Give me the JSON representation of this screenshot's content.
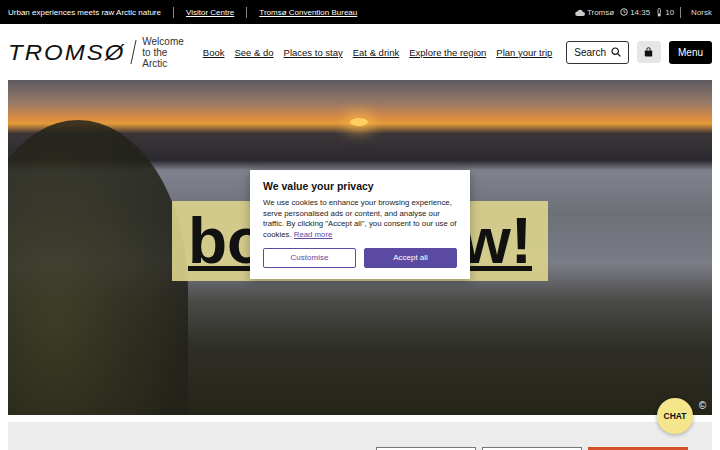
{
  "top_bar": {
    "tagline": "Urban experiences meets raw Arctic nature",
    "links": [
      "Visitor Centre",
      "Tromsø Convention Bureau"
    ],
    "weather": {
      "place": "Tromsø",
      "time": "14:35",
      "temperature": "10"
    },
    "language": "Norsk"
  },
  "header": {
    "logo": "TROMSØ",
    "tagline_lines": [
      "Welcome",
      "to the Arctic"
    ],
    "nav": [
      "Book",
      "See & do",
      "Places to stay",
      "Eat & drink",
      "Explore the region",
      "Plan your trip"
    ],
    "search": "Search",
    "menu": "Menu"
  },
  "hero": {
    "banner": {
      "visible_start": "bo",
      "visible_end": "w!"
    },
    "credit": "©"
  },
  "cookie_dialog": {
    "title": "We value your privacy",
    "body": "We use cookies to enhance your browsing experience, serve personalised ads or content, and analyse our traffic. By clicking \"Accept all\", you consent to our use of cookies.",
    "link": "Read more",
    "buttons": [
      {
        "label": "Customise",
        "kind": "secondary"
      },
      {
        "label": "Accept all",
        "kind": "primary"
      }
    ]
  },
  "chat": {
    "label": "CHAT"
  }
}
